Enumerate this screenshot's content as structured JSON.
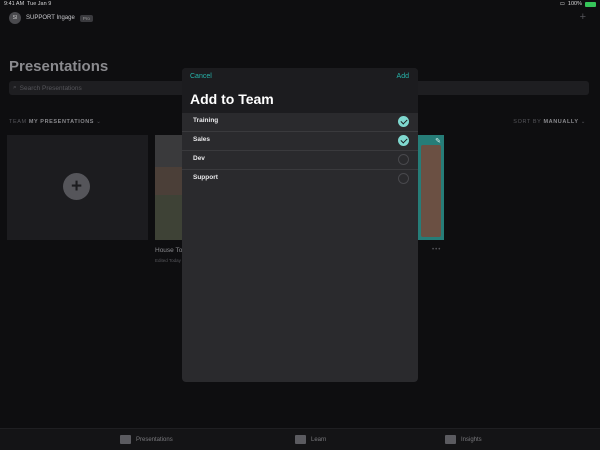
{
  "status": {
    "time": "9:41 AM",
    "date": "Tue Jan 9",
    "battery": "100%"
  },
  "header": {
    "avatar_initials": "SI",
    "org_name": "SUPPORT Ingage",
    "plan_badge": "Pro",
    "add_icon": "plus-icon"
  },
  "page": {
    "title": "Presentations",
    "search_placeholder": "Search Presentations"
  },
  "filters": {
    "team_prefix": "TEAM",
    "team_value": "MY PRESENTATIONS",
    "sort_prefix": "SORT BY",
    "sort_value": "MANUALLY"
  },
  "cards": [
    {
      "title": "House Tour",
      "subtitle": "Edited Today"
    }
  ],
  "modal": {
    "cancel_label": "Cancel",
    "add_label": "Add",
    "title": "Add to Team",
    "teams": [
      {
        "label": "Training",
        "selected": true
      },
      {
        "label": "Sales",
        "selected": true
      },
      {
        "label": "Dev",
        "selected": false
      },
      {
        "label": "Support",
        "selected": false
      }
    ]
  },
  "tabs": [
    {
      "label": "Presentations",
      "icon": "presentations-icon"
    },
    {
      "label": "Learn",
      "icon": "learn-icon"
    },
    {
      "label": "Insights",
      "icon": "insights-icon"
    }
  ],
  "colors": {
    "accent": "#26b5ab",
    "check_fill": "#7fd8cf",
    "modal_bg": "#2a2a2d",
    "app_bg": "#0e0e10"
  }
}
